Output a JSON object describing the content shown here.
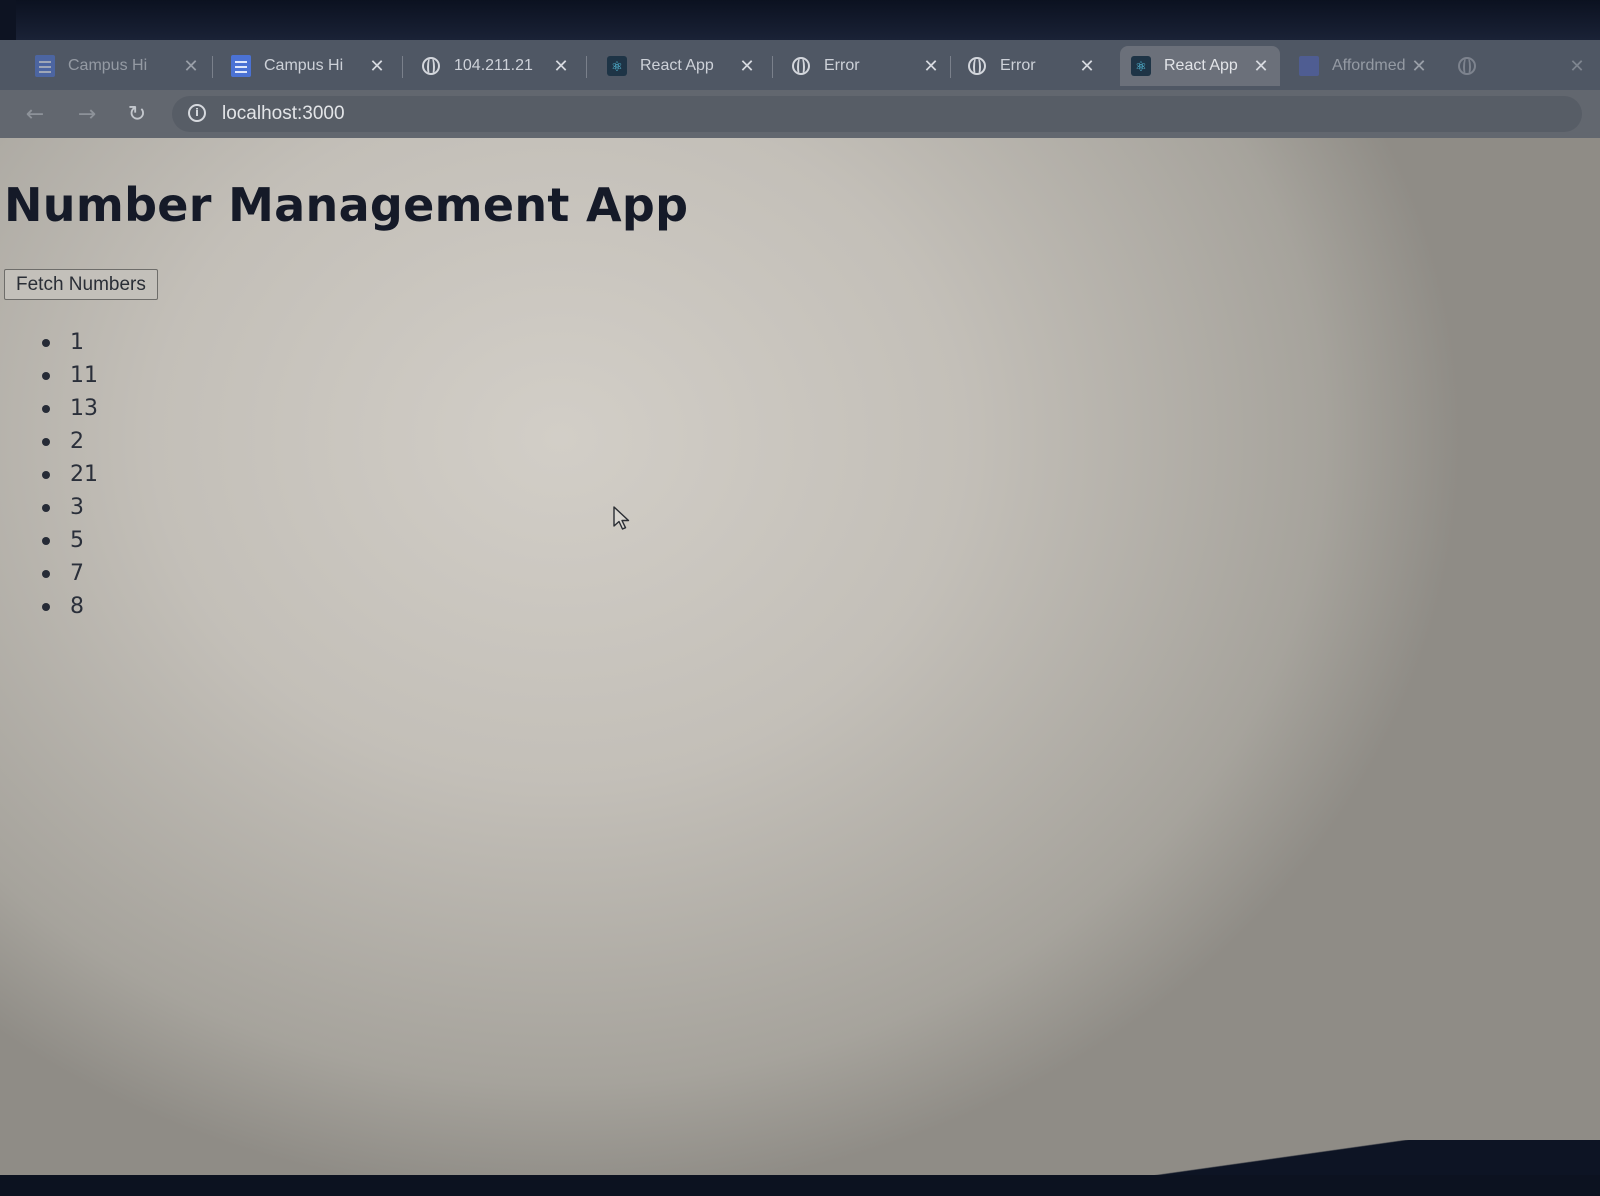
{
  "tabs": [
    {
      "title": "Campus Hi",
      "icon": "doc-icon",
      "active": false
    },
    {
      "title": "Campus Hi",
      "icon": "doc-icon",
      "active": false
    },
    {
      "title": "104.211.21",
      "icon": "globe-icon",
      "active": false
    },
    {
      "title": "React App",
      "icon": "react-icon",
      "active": false
    },
    {
      "title": "Error",
      "icon": "globe-icon",
      "active": false
    },
    {
      "title": "Error",
      "icon": "globe-icon",
      "active": false
    },
    {
      "title": "React App",
      "icon": "react-icon",
      "active": true
    },
    {
      "title": "Affordmed",
      "icon": "sheet-icon",
      "active": false
    }
  ],
  "address_bar": {
    "url": "localhost:3000"
  },
  "page": {
    "title": "Number Management App",
    "fetch_button_label": "Fetch Numbers",
    "numbers": [
      "1",
      "11",
      "13",
      "2",
      "21",
      "3",
      "5",
      "7",
      "8"
    ]
  },
  "colors": {
    "page_text": "#151a28",
    "button_bg": "#c3c0ba",
    "tab_strip": "#4f5764"
  }
}
